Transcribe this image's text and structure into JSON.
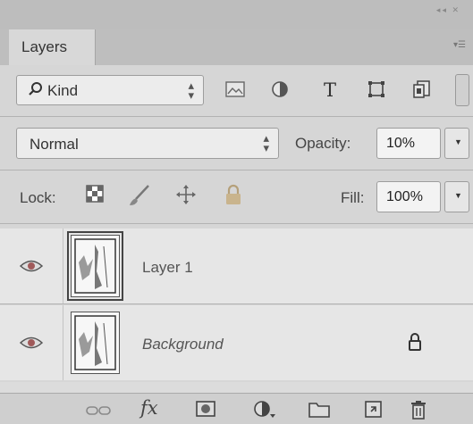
{
  "panel": {
    "tab_label": "Layers"
  },
  "filter": {
    "kind_label": "Kind",
    "icons": [
      "image-filter-icon",
      "adjustment-filter-icon",
      "type-filter-icon",
      "shape-filter-icon",
      "smart-object-filter-icon"
    ]
  },
  "blend": {
    "mode": "Normal",
    "opacity_label": "Opacity:",
    "opacity_value": "10%"
  },
  "lock": {
    "label": "Lock:",
    "icons": [
      "lock-transparent-pixels-icon",
      "lock-image-pixels-icon",
      "lock-position-icon",
      "lock-all-icon"
    ],
    "fill_label": "Fill:",
    "fill_value": "100%"
  },
  "layers": [
    {
      "name": "Layer 1",
      "visible": true,
      "selected": true,
      "locked": false
    },
    {
      "name": "Background",
      "visible": true,
      "selected": false,
      "locked": true
    }
  ],
  "footer_icons": [
    "link-layers-icon",
    "layer-style-fx-icon",
    "add-mask-icon",
    "new-adjustment-layer-icon",
    "new-group-icon",
    "new-layer-icon",
    "delete-layer-icon"
  ],
  "footer": {
    "fx_label": "fx"
  }
}
